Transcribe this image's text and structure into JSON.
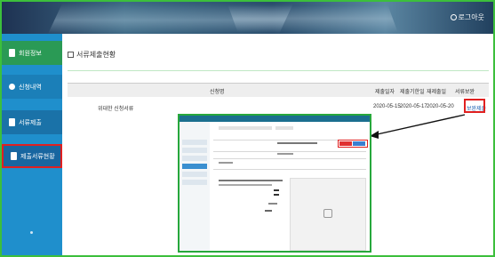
{
  "header": {
    "user_label": "로그아웃"
  },
  "sidebar": {
    "items": [
      {
        "label": "회원정보"
      },
      {
        "label": "신청내역"
      },
      {
        "label": "서류제출"
      },
      {
        "label": "제출서류현황"
      }
    ]
  },
  "main": {
    "title": "서류제출현황",
    "table": {
      "headers": [
        "신청명",
        "제출일자",
        "제출기한일",
        "재제출일",
        "서류보완"
      ],
      "rows": [
        {
          "name": "위대한 신청서류",
          "date1": "2020-05-15",
          "date2": "2020-05-17",
          "date3": "2020-05-20",
          "action": "보완제출"
        }
      ]
    }
  },
  "colors": {
    "sidebar_bg": "#1f8fcc",
    "highlight_red": "#e02020",
    "frame_green": "#3cbf3c"
  }
}
